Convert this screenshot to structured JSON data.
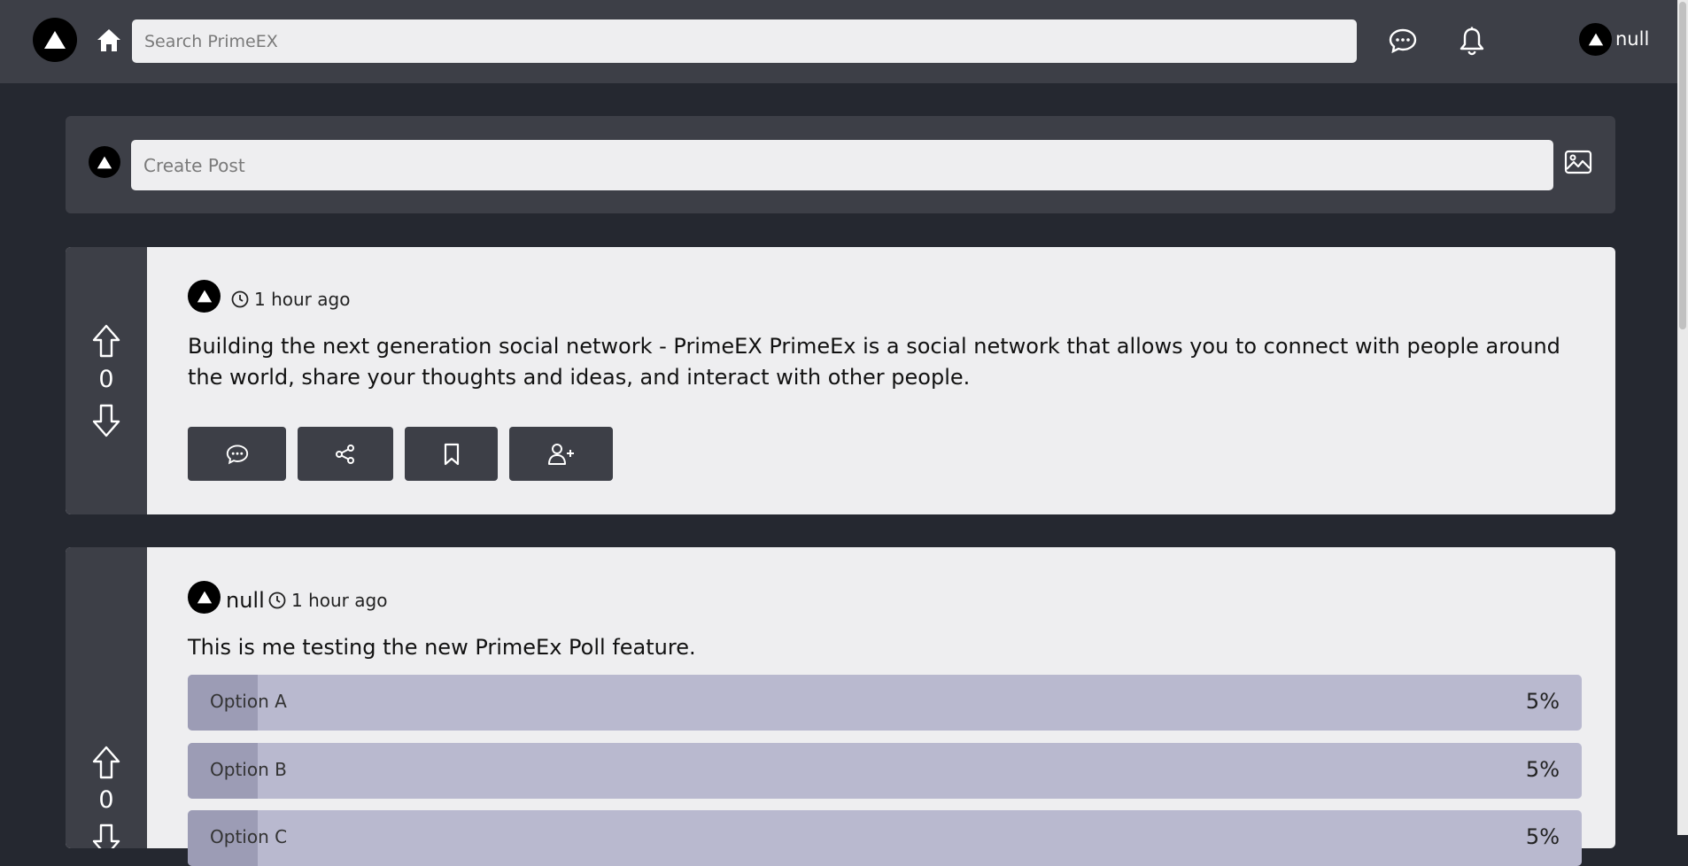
{
  "header": {
    "search_placeholder": "Search PrimeEX",
    "username": "null",
    "logo_icon": "triangle-logo",
    "home_icon": "home-icon",
    "messages_icon": "chat-bubble-icon",
    "notifications_icon": "bell-icon"
  },
  "create_post": {
    "placeholder": "Create Post",
    "image_icon": "image-icon"
  },
  "posts": [
    {
      "author": "",
      "time": "1 hour ago",
      "votes": "0",
      "text": "Building the next generation social network - PrimeEX PrimeEx is a social network that allows you to connect with people around the world, share your thoughts and ideas, and interact with other people.",
      "actions": [
        "comment-icon",
        "share-icon",
        "bookmark-icon",
        "follow-user-icon"
      ]
    },
    {
      "author": "null",
      "time": "1 hour ago",
      "votes": "0",
      "text": "This is me testing the new PrimeEx Poll feature.",
      "poll": [
        {
          "label": "Option A",
          "percent": "5%",
          "fraction": 0.05
        },
        {
          "label": "Option B",
          "percent": "5%",
          "fraction": 0.05
        },
        {
          "label": "Option C",
          "percent": "5%",
          "fraction": 0.05
        }
      ]
    }
  ],
  "colors": {
    "background": "#252830",
    "panel": "#3d3f47",
    "card": "#eeeef0",
    "poll_bar": "#b9b9cf",
    "poll_fill": "#9c9cb5"
  }
}
